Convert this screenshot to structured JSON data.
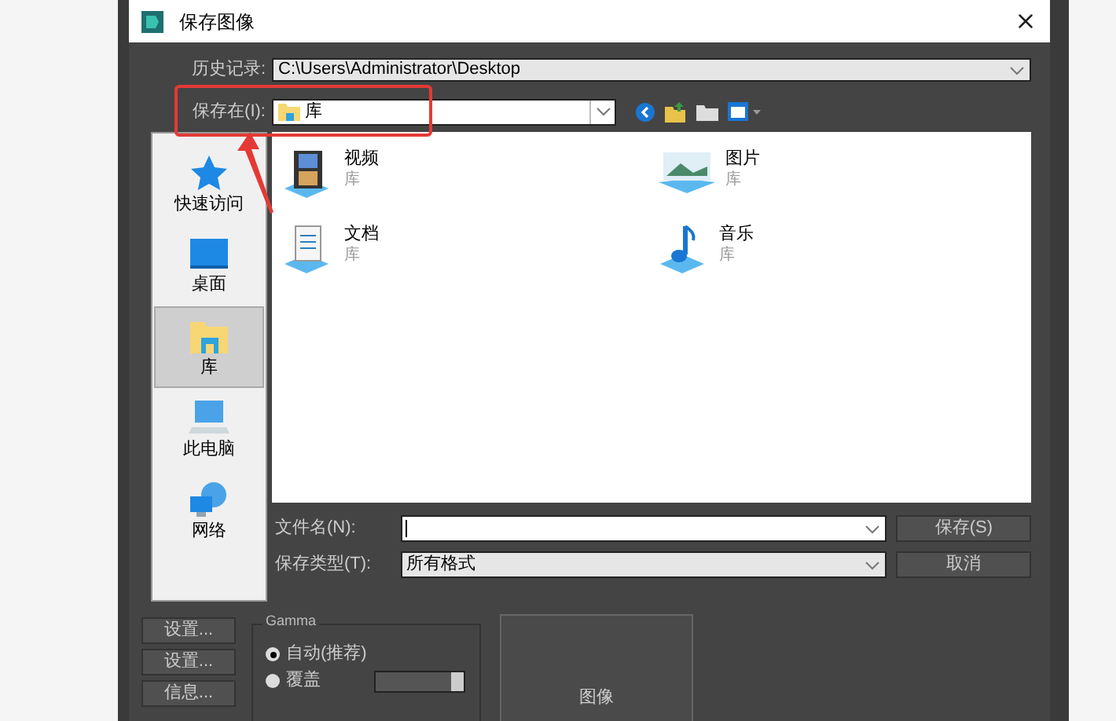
{
  "window": {
    "title": "保存图像"
  },
  "history": {
    "label": "历史记录:",
    "value": "C:\\Users\\Administrator\\Desktop"
  },
  "save_in": {
    "label": "保存在(I):",
    "value": "库"
  },
  "places": [
    {
      "label": "快速访问",
      "kind": "star",
      "selected": false
    },
    {
      "label": "桌面",
      "kind": "desktop",
      "selected": false
    },
    {
      "label": "库",
      "kind": "library",
      "selected": true
    },
    {
      "label": "此电脑",
      "kind": "computer",
      "selected": false
    },
    {
      "label": "网络",
      "kind": "network",
      "selected": false
    }
  ],
  "files": [
    {
      "name": "视频",
      "subtitle": "库",
      "kind": "video"
    },
    {
      "name": "图片",
      "subtitle": "库",
      "kind": "picture"
    },
    {
      "name": "文档",
      "subtitle": "库",
      "kind": "document"
    },
    {
      "name": "音乐",
      "subtitle": "库",
      "kind": "music"
    }
  ],
  "filename": {
    "label": "文件名(N):"
  },
  "filetype": {
    "label": "保存类型(T):",
    "value": "所有格式"
  },
  "buttons": [
    "保存(S)",
    "取消"
  ],
  "side_buttons": [
    "设置...",
    "设置...",
    "信息..."
  ],
  "gamma": {
    "title": "Gamma",
    "options": [
      {
        "label": "自动(推荐)",
        "selected": true
      },
      {
        "label": "覆盖",
        "selected": false
      }
    ]
  },
  "preview": {
    "label": "图像"
  }
}
